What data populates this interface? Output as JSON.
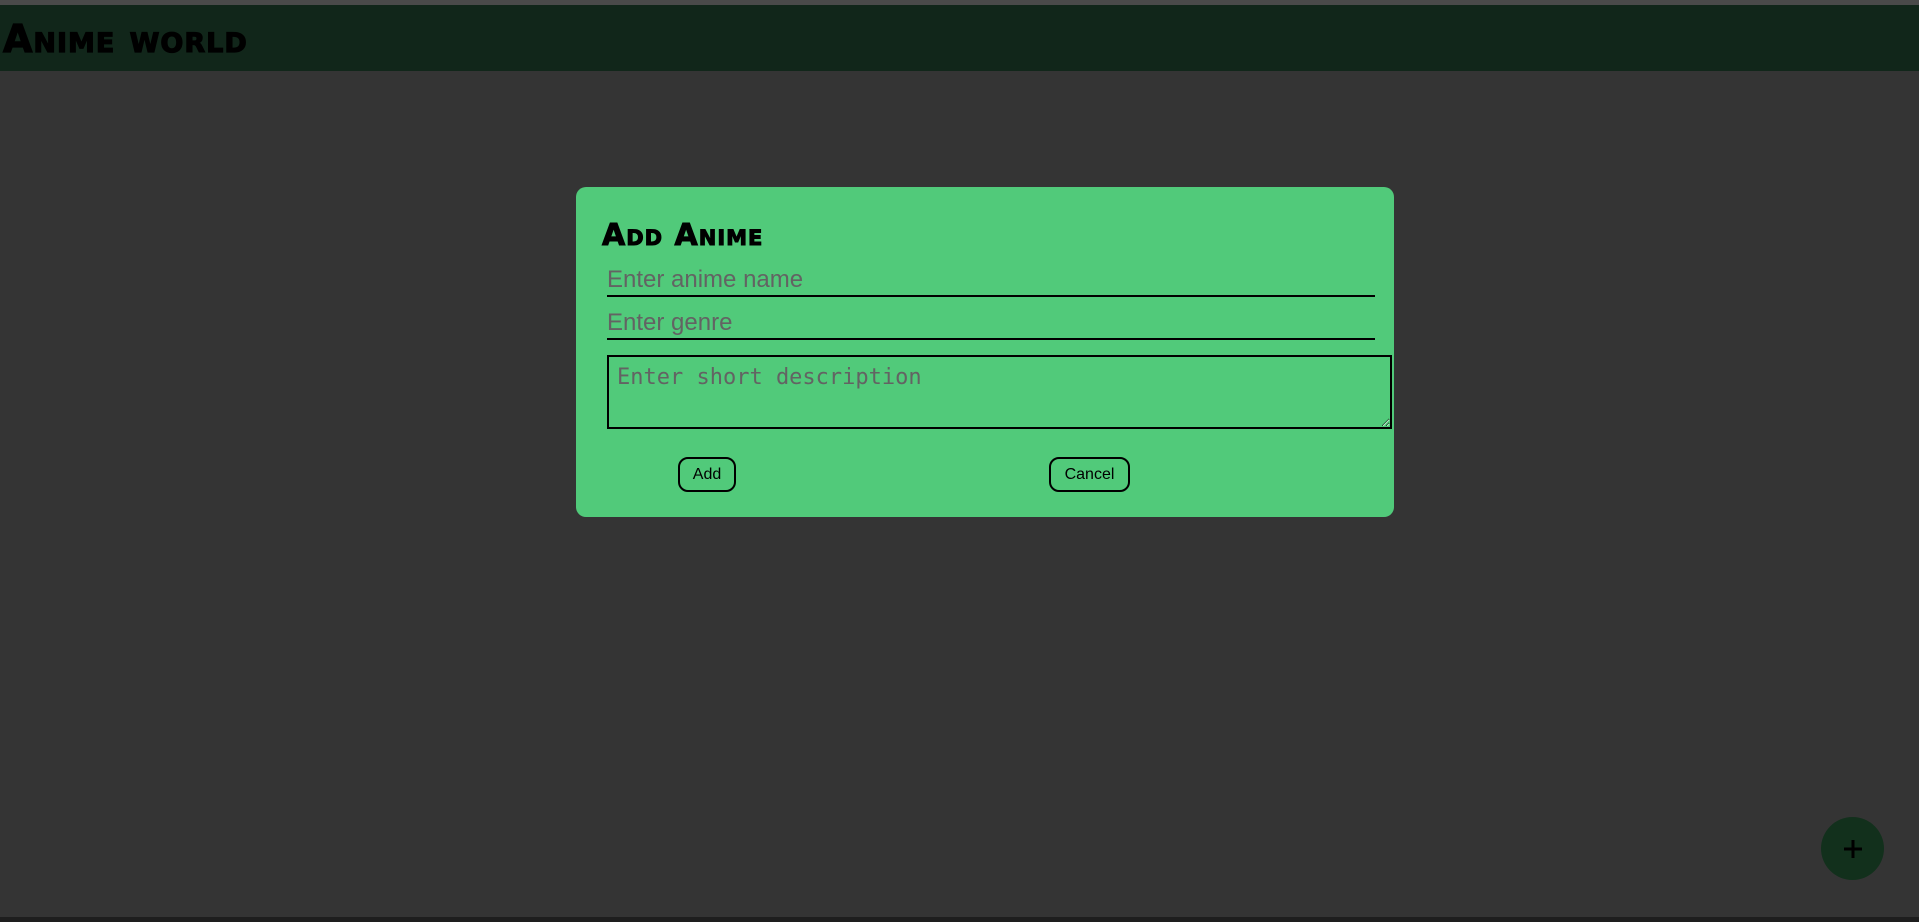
{
  "header": {
    "title": "Anime world"
  },
  "modal": {
    "title": "Add Anime",
    "name_placeholder": "Enter anime name",
    "genre_placeholder": "Enter genre",
    "description_placeholder": "Enter short description",
    "add_label": "Add",
    "cancel_label": "Cancel"
  },
  "fab": {
    "icon": "plus-icon"
  },
  "colors": {
    "page_background": "#343434",
    "header_background": "#11261a",
    "modal_background": "#51ca7a",
    "fab_background": "#12301c"
  }
}
